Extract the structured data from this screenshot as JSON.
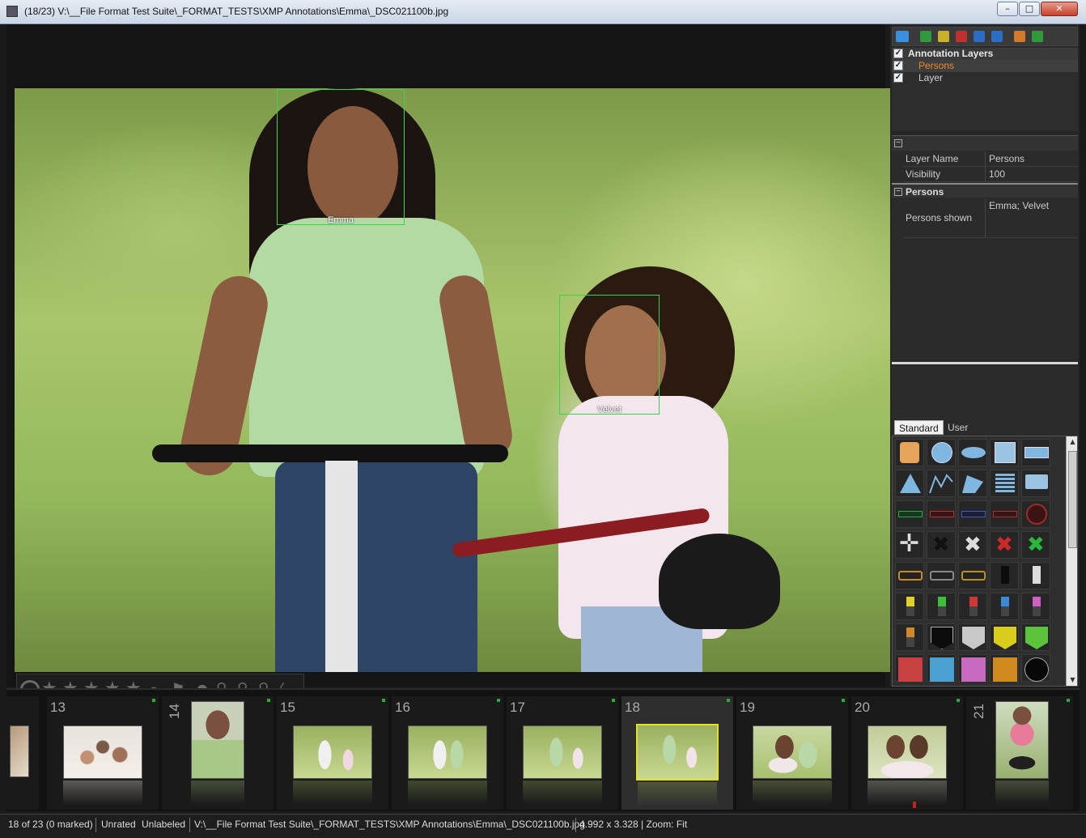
{
  "window": {
    "title": "(18/23) V:\\__File Format Test Suite\\_FORMAT_TESTS\\XMP Annotations\\Emma\\_DSC021100b.jpg",
    "btn_min": "–",
    "btn_max": "□",
    "btn_close": "✕"
  },
  "annotations": [
    {
      "label": "Emma"
    },
    {
      "label": "Velvet"
    }
  ],
  "rating": {
    "stars": 0,
    "max_stars": 5
  },
  "layers": {
    "root": "Annotation Layers",
    "items": [
      {
        "label": "Persons",
        "selected": true
      },
      {
        "label": "Layer",
        "selected": false
      }
    ]
  },
  "properties": {
    "section1": {
      "rows": [
        {
          "key": "Layer Name",
          "value": "Persons"
        },
        {
          "key": "Visibility",
          "value": "100"
        }
      ]
    },
    "section2": {
      "title": "Persons",
      "rows": [
        {
          "key": "Persons shown",
          "value": "Emma; Velvet"
        }
      ]
    }
  },
  "shape_tabs": {
    "standard": "Standard",
    "user": "User"
  },
  "filmstrip": {
    "frames": [
      {
        "num": "13"
      },
      {
        "num": "14"
      },
      {
        "num": "15"
      },
      {
        "num": "16"
      },
      {
        "num": "17"
      },
      {
        "num": "18"
      },
      {
        "num": "19"
      },
      {
        "num": "20"
      },
      {
        "num": "21"
      }
    ],
    "selected": "18"
  },
  "status": {
    "count": "18 of 23 (0 marked)",
    "rating": "Unrated",
    "label": "Unlabeled",
    "path": "V:\\__File Format Test Suite\\_FORMAT_TESTS\\XMP Annotations\\Emma\\_DSC021100b.jpg",
    "dims": "4.992 x 3.328 | Zoom: Fit"
  },
  "colors": {
    "accent_selected": "#e4e21e",
    "face_box": "#35d64a",
    "layer_selected": "#f08a28"
  }
}
